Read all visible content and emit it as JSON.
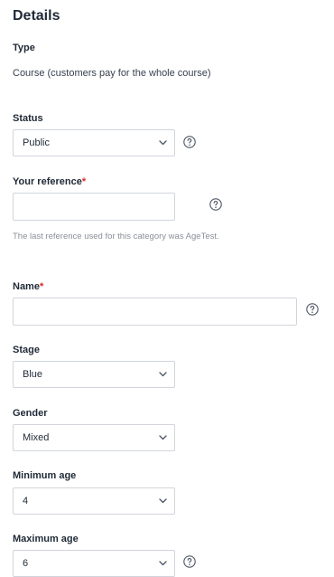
{
  "page": {
    "title": "Details"
  },
  "type": {
    "label": "Type",
    "value": "Course (customers pay for the whole course)"
  },
  "status": {
    "label": "Status",
    "value": "Public",
    "help_icon": "question-circle-icon"
  },
  "reference": {
    "label": "Your reference",
    "required_mark": "*",
    "value": "",
    "help_icon": "question-circle-icon",
    "help_text": "The last reference used for this category was AgeTest."
  },
  "name": {
    "label": "Name",
    "required_mark": "*",
    "value": "",
    "help_icon": "question-circle-icon"
  },
  "stage": {
    "label": "Stage",
    "value": "Blue"
  },
  "gender": {
    "label": "Gender",
    "value": "Mixed"
  },
  "min_age": {
    "label": "Minimum age",
    "value": "4"
  },
  "max_age": {
    "label": "Maximum age",
    "value": "6",
    "help_icon": "question-circle-icon"
  },
  "colors": {
    "required": "#e02424",
    "border": "#d1d5db",
    "text": "#1f2937",
    "muted": "#8b8f98"
  }
}
